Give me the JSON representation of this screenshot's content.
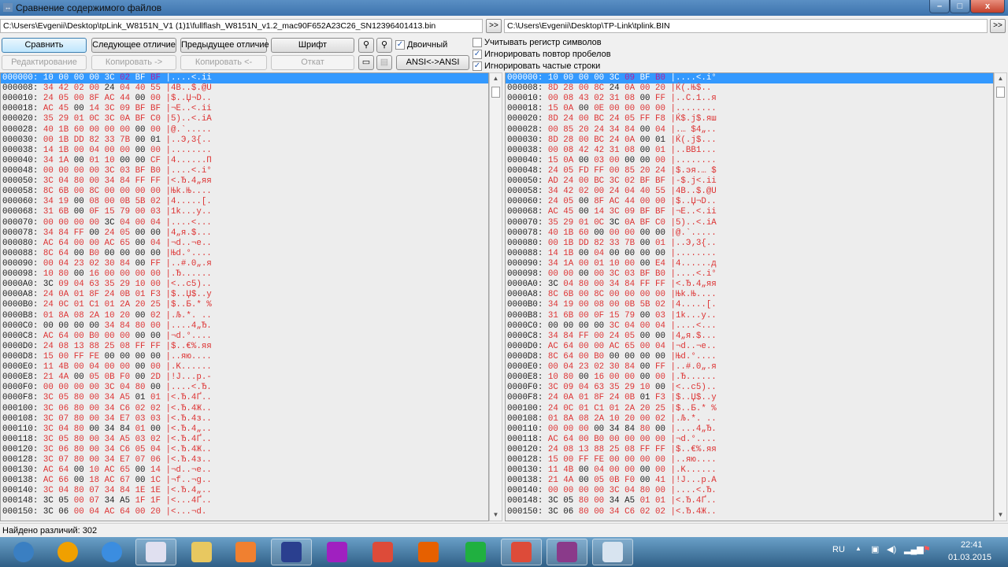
{
  "window": {
    "title": "Сравнение содержимого файлов",
    "minimize": "–",
    "maximize": "□",
    "close": "x"
  },
  "paths": {
    "left": "C:\\Users\\Evgenii\\Desktop\\tpLink_W8151N_V1 (1)1\\fullflash_W8151N_v1.2_mac90F652A23C26_SN12396401413.bin",
    "right": "C:\\Users\\Evgenii\\Desktop\\TP-Link\\tplink.BIN",
    "browse": ">>"
  },
  "toolbar": {
    "compare": "Сравнить",
    "next_diff": "Следующее отличие",
    "prev_diff": "Предыдущее отличие",
    "font": "Шрифт",
    "edit": "Редактирование",
    "copy_right": "Копировать ->",
    "copy_left": "Копировать <-",
    "undo": "Откат",
    "ansi": "ANSI<->ANSI",
    "binary": "Двоичный",
    "binary_checked": true
  },
  "options": [
    {
      "label": "Учитывать регистр символов",
      "checked": false
    },
    {
      "label": "Игнорировать повтор пробелов",
      "checked": true
    },
    {
      "label": "Игнорировать частые строки",
      "checked": true
    }
  ],
  "left_rows": [
    [
      "000000:",
      "10 00 00 00 3C 02 BF BF",
      "|....<.ii"
    ],
    [
      "000008:",
      "34 42 02 00 24 04 40 55",
      "|4B..$.@U"
    ],
    [
      "000010:",
      "24 05 00 8F AC 44 00 00",
      "|$..Џ¬D.."
    ],
    [
      "000018:",
      "AC 45 00 14 3C 09 BF BF",
      "|¬E..<.ii"
    ],
    [
      "000020:",
      "35 29 01 0C 3C 0A BF C0",
      "|5)..<.iA"
    ],
    [
      "000028:",
      "40 1B 60 00 00 00 00 00",
      "|@.`....."
    ],
    [
      "000030:",
      "00 1B DD 82 33 7B 00 01",
      "|..Э‚3{.."
    ],
    [
      "000038:",
      "14 1B 00 04 00 00 00 00",
      "|........"
    ],
    [
      "000040:",
      "34 1A 00 01 10 00 00 CF",
      "|4......П"
    ],
    [
      "000048:",
      "00 00 00 00 3C 03 BF B0",
      "|....<.i°"
    ],
    [
      "000050:",
      "3C 04 80 00 34 84 FF FF",
      "|<.Ђ.4„яя"
    ],
    [
      "000058:",
      "8C 6B 00 8C 00 00 00 00",
      "|Њk.Њ...."
    ],
    [
      "000060:",
      "34 19 00 08 00 0B 5B 02",
      "|4.....[."
    ],
    [
      "000068:",
      "31 6B 00 0F 15 79 00 03",
      "|1k...y.."
    ],
    [
      "000070:",
      "00 00 00 00 3C 04 00 04",
      "|....<..."
    ],
    [
      "000078:",
      "34 84 FF 00 24 05 00 00",
      "|4„я.$..."
    ],
    [
      "000080:",
      "AC 64 00 00 AC 65 00 04",
      "|¬d..¬e.."
    ],
    [
      "000088:",
      "8C 64 00 B0 00 00 00 00",
      "|Њd.°...."
    ],
    [
      "000090:",
      "00 04 23 02 30 84 00 FF",
      "|..#.0„.я"
    ],
    [
      "000098:",
      "10 80 00 16 00 00 00 00",
      "|.Ђ......"
    ],
    [
      "0000A0:",
      "3C 09 04 63 35 29 10 00",
      "|<..c5).."
    ],
    [
      "0000A8:",
      "24 0A 01 8F 24 0B 01 F3",
      "|$..Џ$..у"
    ],
    [
      "0000B0:",
      "24 0C 01 C1 01 2A 20 25",
      "|$..Б.* %"
    ],
    [
      "0000B8:",
      "01 8A 08 2A 10 20 00 02",
      "|.Љ.*. .."
    ],
    [
      "0000C0:",
      "00 00 00 00 34 84 80 00",
      "|....4„Ђ."
    ],
    [
      "0000C8:",
      "AC 64 00 B0 00 00 00 00",
      "|¬d.°...."
    ],
    [
      "0000D0:",
      "24 08 13 88 25 08 FF FF",
      "|$..€%.яя"
    ],
    [
      "0000D8:",
      "15 00 FF FE 00 00 00 00",
      "|..яю...."
    ],
    [
      "0000E0:",
      "11 4B 00 04 00 00 00 00",
      "|.K......"
    ],
    [
      "0000E8:",
      "21 4A 00 05 0B F0 00 2D",
      "|!J...р.-"
    ],
    [
      "0000F0:",
      "00 00 00 00 3C 04 80 00",
      "|....<.Ђ."
    ],
    [
      "0000F8:",
      "3C 05 80 00 34 A5 01 01",
      "|<.Ђ.4Ґ.."
    ],
    [
      "000100:",
      "3C 06 80 00 34 C6 02 02",
      "|<.Ђ.4Ж.."
    ],
    [
      "000108:",
      "3C 07 80 00 34 E7 03 03",
      "|<.Ђ.4з.."
    ],
    [
      "000110:",
      "3C 04 80 00 34 84 01 00",
      "|<.Ђ.4„.."
    ],
    [
      "000118:",
      "3C 05 80 00 34 A5 03 02",
      "|<.Ђ.4Ґ.."
    ],
    [
      "000120:",
      "3C 06 80 00 34 C6 05 04",
      "|<.Ђ.4Ж.."
    ],
    [
      "000128:",
      "3C 07 80 00 34 E7 07 06",
      "|<.Ђ.4з.."
    ],
    [
      "000130:",
      "AC 64 00 10 AC 65 00 14",
      "|¬d..¬e.."
    ],
    [
      "000138:",
      "AC 66 00 18 AC 67 00 1C",
      "|¬f..¬g.."
    ],
    [
      "000140:",
      "3C 04 80 07 34 84 1E 1E",
      "|<.Ђ.4„.."
    ],
    [
      "000148:",
      "3C 05 00 07 34 A5 1F 1F",
      "|<...4Ґ.."
    ],
    [
      "000150:",
      "3C 06 00 04 AC 64 00 20",
      "|<...¬d. "
    ]
  ],
  "right_rows": [
    [
      "000000:",
      "10 00 00 00 3C 09 BF B0",
      "|....<.i°"
    ],
    [
      "000008:",
      "8D 28 00 8C 24 0A 00 20",
      "|Ќ(.Њ$.. "
    ],
    [
      "000010:",
      "00 08 43 02 31 08 00 FF",
      "|..C.1..я"
    ],
    [
      "000018:",
      "15 0A 00 0E 00 00 00 00",
      "|........"
    ],
    [
      "000020:",
      "8D 24 00 BC 24 05 FF F8",
      "|Ќ$.ј$.яш"
    ],
    [
      "000028:",
      "00 85 20 24 34 84 00 04",
      "|.… $4„.."
    ],
    [
      "000030:",
      "8D 28 00 BC 24 0A 00 01",
      "|Ќ(.ј$..."
    ],
    [
      "000038:",
      "00 08 42 42 31 08 00 01",
      "|..BB1..."
    ],
    [
      "000040:",
      "15 0A 00 03 00 00 00 00",
      "|........"
    ],
    [
      "000048:",
      "24 05 FD FF 00 85 20 24",
      "|$.эя.… $"
    ],
    [
      "000050:",
      "AD 24 00 BC 3C 02 BF BF",
      "|-$.ј<.ii"
    ],
    [
      "000058:",
      "34 42 02 00 24 04 40 55",
      "|4B..$.@U"
    ],
    [
      "000060:",
      "24 05 00 8F AC 44 00 00",
      "|$..Џ¬D.."
    ],
    [
      "000068:",
      "AC 45 00 14 3C 09 BF BF",
      "|¬E..<.ii"
    ],
    [
      "000070:",
      "35 29 01 0C 3C 0A BF C0",
      "|5)..<.iA"
    ],
    [
      "000078:",
      "40 1B 60 00 00 00 00 00",
      "|@.`....."
    ],
    [
      "000080:",
      "00 1B DD 82 33 7B 00 01",
      "|..Э‚3{.."
    ],
    [
      "000088:",
      "14 1B 00 04 00 00 00 00",
      "|........"
    ],
    [
      "000090:",
      "34 1A 00 01 10 00 00 E4",
      "|4......д"
    ],
    [
      "000098:",
      "00 00 00 00 3C 03 BF B0",
      "|....<.i°"
    ],
    [
      "0000A0:",
      "3C 04 80 00 34 84 FF FF",
      "|<.Ђ.4„яя"
    ],
    [
      "0000A8:",
      "8C 6B 00 8C 00 00 00 00",
      "|Њk.Њ...."
    ],
    [
      "0000B0:",
      "34 19 00 08 00 0B 5B 02",
      "|4.....[."
    ],
    [
      "0000B8:",
      "31 6B 00 0F 15 79 00 03",
      "|1k...y.."
    ],
    [
      "0000C0:",
      "00 00 00 00 3C 04 00 04",
      "|....<..."
    ],
    [
      "0000C8:",
      "34 84 FF 00 24 05 00 00",
      "|4„я.$..."
    ],
    [
      "0000D0:",
      "AC 64 00 00 AC 65 00 04",
      "|¬d..¬e.."
    ],
    [
      "0000D8:",
      "8C 64 00 B0 00 00 00 00",
      "|Њd.°...."
    ],
    [
      "0000E0:",
      "00 04 23 02 30 84 00 FF",
      "|..#.0„.я"
    ],
    [
      "0000E8:",
      "10 80 00 16 00 00 00 00",
      "|.Ђ......"
    ],
    [
      "0000F0:",
      "3C 09 04 63 35 29 10 00",
      "|<..c5).."
    ],
    [
      "0000F8:",
      "24 0A 01 8F 24 0B 01 F3",
      "|$..Џ$..у"
    ],
    [
      "000100:",
      "24 0C 01 C1 01 2A 20 25",
      "|$..Б.* %"
    ],
    [
      "000108:",
      "01 8A 08 2A 10 20 00 02",
      "|.Љ.*. .."
    ],
    [
      "000110:",
      "00 00 00 00 34 84 80 00",
      "|....4„Ђ."
    ],
    [
      "000118:",
      "AC 64 00 B0 00 00 00 00",
      "|¬d.°...."
    ],
    [
      "000120:",
      "24 08 13 88 25 08 FF FF",
      "|$..€%.яя"
    ],
    [
      "000128:",
      "15 00 FF FE 00 00 00 00",
      "|..яю...."
    ],
    [
      "000130:",
      "11 4B 00 04 00 00 00 00",
      "|.K......"
    ],
    [
      "000138:",
      "21 4A 00 05 0B F0 00 41",
      "|!J...р.A"
    ],
    [
      "000140:",
      "00 00 00 00 3C 04 80 00",
      "|....<.Ђ."
    ],
    [
      "000148:",
      "3C 05 80 00 34 A5 01 01",
      "|<.Ђ.4Ґ.."
    ],
    [
      "000150:",
      "3C 06 80 00 34 C6 02 02",
      "|<.Ђ.4Ж.."
    ]
  ],
  "status": "Найдено различий: 302",
  "taskbar": {
    "apps": [
      {
        "name": "start",
        "color": "#3a7fc2",
        "open": false
      },
      {
        "name": "aimp",
        "color": "#f0a000",
        "open": false
      },
      {
        "name": "internet-explorer",
        "color": "#3b8de0",
        "open": false
      },
      {
        "name": "paint",
        "color": "#e0e0f0",
        "open": true
      },
      {
        "name": "explorer",
        "color": "#e8c860",
        "open": false
      },
      {
        "name": "media-player",
        "color": "#f08030",
        "open": false
      },
      {
        "name": "save-app",
        "color": "#2a3f8f",
        "open": true
      },
      {
        "name": "hex-editor",
        "color": "#a020c0",
        "open": false
      },
      {
        "name": "chrome",
        "color": "#dd4b39",
        "open": false
      },
      {
        "name": "firefox",
        "color": "#e66000",
        "open": false
      },
      {
        "name": "mail-agent",
        "color": "#20b040",
        "open": false
      },
      {
        "name": "chrome-2",
        "color": "#dd4b39",
        "open": true
      },
      {
        "name": "winrar",
        "color": "#8a3a8a",
        "open": true
      },
      {
        "name": "file-compare",
        "color": "#d8e4f0",
        "open": true
      }
    ],
    "lang": "RU",
    "time": "22:41",
    "date": "01.03.2015"
  }
}
